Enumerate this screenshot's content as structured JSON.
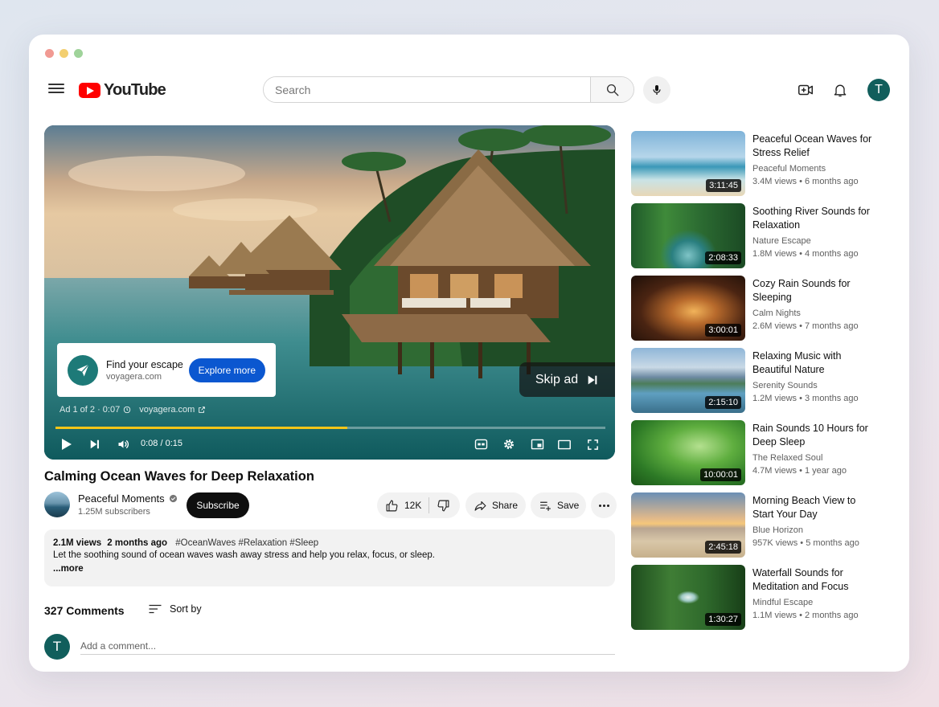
{
  "header": {
    "logo_text": "YouTube",
    "search_placeholder": "Search",
    "avatar_letter": "T"
  },
  "player": {
    "ad": {
      "title": "Find your escape",
      "url": "voyagera.com",
      "cta_label": "Explore more",
      "info_counter": "Ad 1 of 2 · 0:07",
      "info_url": "voyagera.com"
    },
    "skip_label": "Skip ad",
    "time_display": "0:08 / 0:15",
    "progress_fraction": 0.53
  },
  "video": {
    "title": "Calming Ocean Waves for Deep Relaxation",
    "channel_name": "Peaceful Moments",
    "subscribers": "1.25M subscribers",
    "subscribe_label": "Subscribe",
    "likes": "12K",
    "share_label": "Share",
    "save_label": "Save",
    "description": {
      "views": "2.1M views",
      "age": "2 months ago",
      "tags": "#OceanWaves #Relaxation #Sleep",
      "text": "Let the soothing sound of ocean waves wash away stress and help you relax, focus, or sleep.",
      "more_label": "...more"
    }
  },
  "comments": {
    "count_label": "327 Comments",
    "sort_label": "Sort by",
    "input_placeholder": "Add a comment...",
    "avatar_letter": "T"
  },
  "sidebar": {
    "items": [
      {
        "title": "Peaceful Ocean Waves for Stress Relief",
        "channel": "Peaceful Moments",
        "meta": "3.4M views • 6 months ago",
        "duration": "3:11:45"
      },
      {
        "title": "Soothing River Sounds for Relaxation",
        "channel": "Nature Escape",
        "meta": "1.8M views • 4 months ago",
        "duration": "2:08:33"
      },
      {
        "title": "Cozy Rain Sounds for Sleeping",
        "channel": "Calm Nights",
        "meta": "2.6M views • 7 months ago",
        "duration": "3:00:01"
      },
      {
        "title": "Relaxing Music with Beautiful Nature",
        "channel": "Serenity Sounds",
        "meta": "1.2M views • 3 months ago",
        "duration": "2:15:10"
      },
      {
        "title": "Rain Sounds 10 Hours for Deep Sleep",
        "channel": "The Relaxed Soul",
        "meta": "4.7M views • 1 year ago",
        "duration": "10:00:01"
      },
      {
        "title": "Morning Beach View to Start Your Day",
        "channel": "Blue Horizon",
        "meta": "957K views • 5 months ago",
        "duration": "2:45:18"
      },
      {
        "title": "Waterfall Sounds for Meditation and Focus",
        "channel": "Mindful Escape",
        "meta": "1.1M views • 2 months ago",
        "duration": "1:30:27"
      }
    ]
  },
  "colors": {
    "brand_red": "#ff0000",
    "progress_yellow": "#f5c518",
    "cta_blue": "#0b57d0",
    "avatar_teal": "#115e5c"
  }
}
